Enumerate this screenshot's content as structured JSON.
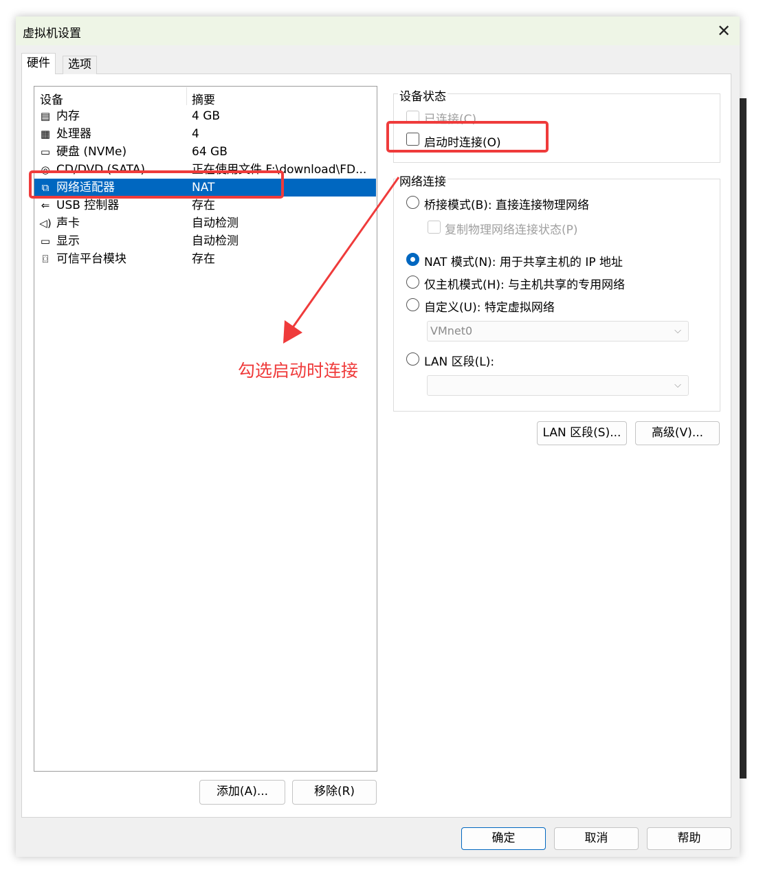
{
  "window": {
    "title": "虚拟机设置",
    "close_icon": "close-icon"
  },
  "tabs": [
    {
      "label": "硬件",
      "active": true
    },
    {
      "label": "选项",
      "active": false
    }
  ],
  "device_list": {
    "headers": {
      "device": "设备",
      "summary": "摘要"
    },
    "rows": [
      {
        "icon": "memory-icon",
        "name": "内存",
        "summary": "4 GB",
        "selected": false
      },
      {
        "icon": "processor-icon",
        "name": "处理器",
        "summary": "4",
        "selected": false
      },
      {
        "icon": "harddisk-icon",
        "name": "硬盘 (NVMe)",
        "summary": "64 GB",
        "selected": false
      },
      {
        "icon": "cd-dvd-icon",
        "name": "CD/DVD (SATA)",
        "summary": "正在使用文件 F:\\download\\FD...",
        "selected": false
      },
      {
        "icon": "network-adapter-icon",
        "name": "网络适配器",
        "summary": "NAT",
        "selected": true
      },
      {
        "icon": "usb-icon",
        "name": "USB 控制器",
        "summary": "存在",
        "selected": false
      },
      {
        "icon": "sound-icon",
        "name": "声卡",
        "summary": "自动检测",
        "selected": false
      },
      {
        "icon": "display-icon",
        "name": "显示",
        "summary": "自动检测",
        "selected": false
      },
      {
        "icon": "tpm-icon",
        "name": "可信平台模块",
        "summary": "存在",
        "selected": false
      }
    ],
    "add_button": "添加(A)...",
    "remove_button": "移除(R)"
  },
  "device_status": {
    "title": "设备状态",
    "connected": {
      "label": "已连接(C)",
      "checked": false,
      "disabled": true
    },
    "connect_at_power_on": {
      "label": "启动时连接(O)",
      "checked": false,
      "disabled": false
    }
  },
  "network_connection": {
    "title": "网络连接",
    "bridged": {
      "label": "桥接模式(B): 直接连接物理网络",
      "selected": false
    },
    "replicate": {
      "label": "复制物理网络连接状态(P)",
      "checked": false,
      "disabled": true
    },
    "nat": {
      "label": "NAT 模式(N): 用于共享主机的 IP 地址",
      "selected": true
    },
    "host_only": {
      "label": "仅主机模式(H): 与主机共享的专用网络",
      "selected": false
    },
    "custom": {
      "label": "自定义(U): 特定虚拟网络",
      "selected": false
    },
    "custom_select": {
      "value": "VMnet0"
    },
    "lan_segment": {
      "label": "LAN 区段(L):",
      "selected": false
    },
    "lan_select": {
      "value": ""
    }
  },
  "panel_buttons": {
    "lan_segments": "LAN 区段(S)...",
    "advanced": "高级(V)..."
  },
  "footer": {
    "ok": "确定",
    "cancel": "取消",
    "help": "帮助"
  },
  "annotation": {
    "text": "勾选启动时连接",
    "color": "#ef3b3b"
  },
  "colors": {
    "selection": "#0067c0",
    "annotation": "#ef3b3b",
    "titlebar": "#eef5e6"
  }
}
